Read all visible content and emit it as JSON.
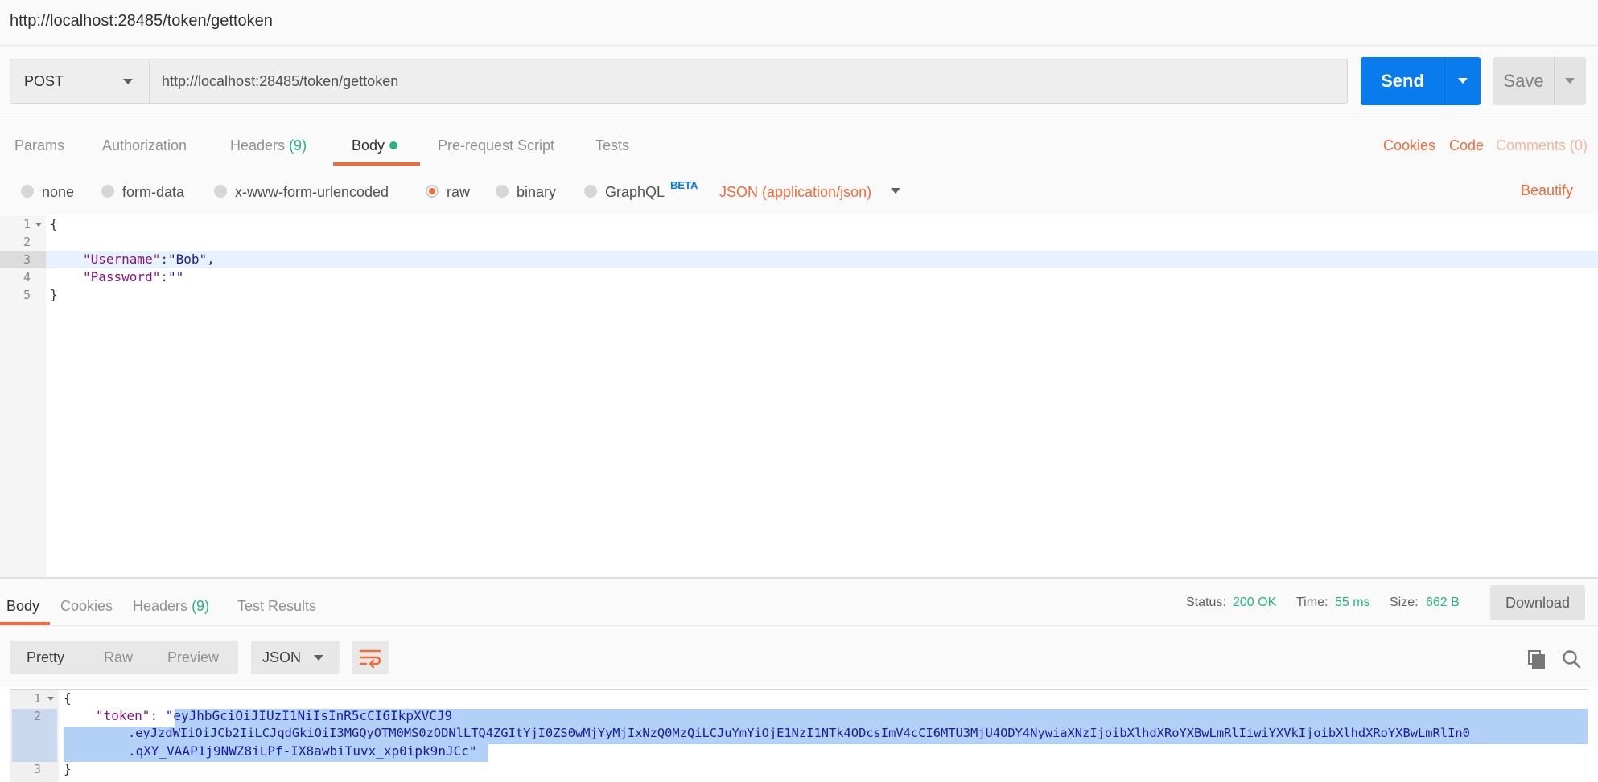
{
  "window": {
    "title": "http://localhost:28485/token/gettoken"
  },
  "request": {
    "method": "POST",
    "url": "http://localhost:28485/token/gettoken",
    "send_label": "Send",
    "save_label": "Save"
  },
  "request_tabs": {
    "params": "Params",
    "authorization": "Authorization",
    "headers": "Headers",
    "headers_count": "(9)",
    "body": "Body",
    "prerequest": "Pre-request Script",
    "tests": "Tests",
    "cookies": "Cookies",
    "code": "Code",
    "comments": "Comments (0)",
    "active": "Body"
  },
  "body_types": {
    "options": [
      "none",
      "form-data",
      "x-www-form-urlencoded",
      "raw",
      "binary",
      "GraphQL"
    ],
    "selected": "raw",
    "graphql_badge": "BETA",
    "content_type": "JSON (application/json)",
    "beautify": "Beautify"
  },
  "request_body": {
    "line_numbers": [
      "1",
      "2",
      "3",
      "4",
      "5"
    ],
    "lines": {
      "l1": "{",
      "l3_key": "\"Username\"",
      "l3_colon": ":",
      "l3_val": "\"Bob\"",
      "l3_comma": ",",
      "l4_key": "\"Password\"",
      "l4_colon": ":",
      "l4_val": "\"\"",
      "l5": "}"
    }
  },
  "response_tabs": {
    "body": "Body",
    "cookies": "Cookies",
    "headers": "Headers",
    "headers_count": "(9)",
    "test_results": "Test Results",
    "active": "Body"
  },
  "response_meta": {
    "status_label": "Status:",
    "status_value": "200 OK",
    "time_label": "Time:",
    "time_value": "55 ms",
    "size_label": "Size:",
    "size_value": "662 B",
    "download": "Download"
  },
  "response_view": {
    "modes": [
      "Pretty",
      "Raw",
      "Preview"
    ],
    "active_mode": "Pretty",
    "format": "JSON"
  },
  "response_body": {
    "line_numbers": [
      "1",
      "2",
      "3"
    ],
    "open_brace": "{",
    "token_key": "\"token\"",
    "colon": ": ",
    "quote_open": "\"",
    "token_part1": "eyJhbGciOiJIUzI1NiIsInR5cCI6IkpXVCJ9",
    "token_part2": ".eyJzdWIiOiJCb2IiLCJqdGkiOiI3MGQyOTM0MS0zODNlLTQ4ZGItYjI0ZS0wMjYyMjIxNzQ0MzQiLCJuYmYiOjE1NzI1NTk4ODcsImV4cCI6MTU3MjU4ODY4NywiaXNzIjoibXlhdXRoYXBwLmRlIiwiYXVkIjoibXlhdXRoYXBwLmRlIn0",
    "token_part3": ".qXY_VAAP1j9NWZ8iLPf-IX8awbiTuvx_xp0ipk9nJCc",
    "quote_close": "\"",
    "close_brace": "}"
  },
  "colors": {
    "accent": "#f26b3a",
    "primary": "#097bed",
    "success": "#26b47f"
  }
}
